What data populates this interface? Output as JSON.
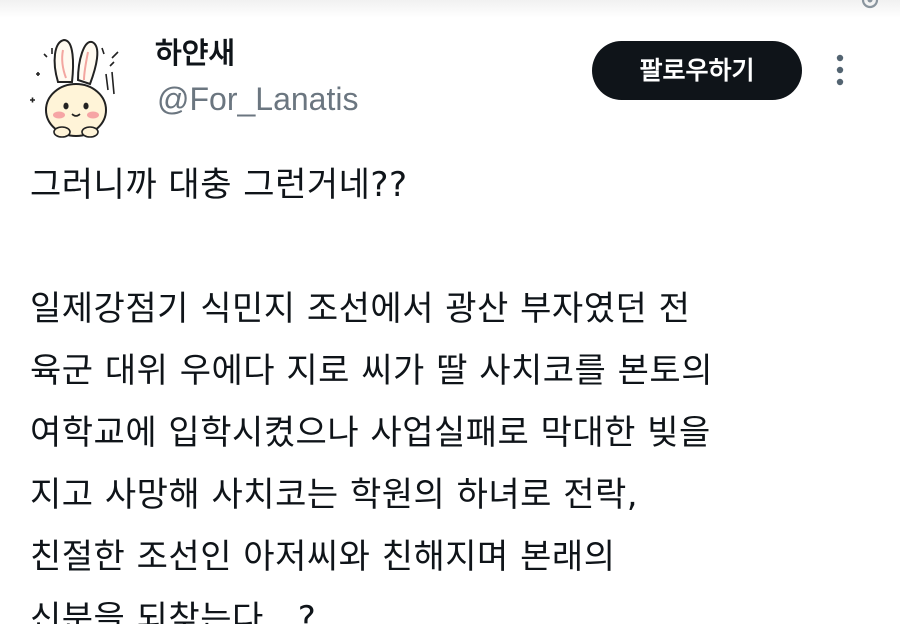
{
  "tweet": {
    "author": {
      "display_name": "하얀새",
      "handle": "@For_Lanatis",
      "avatar_icon": "bunny-avatar-icon"
    },
    "follow_label": "팔로우하기",
    "more_icon": "vertical-dots-icon",
    "body": {
      "line1": "그러니까 대충 그런거네??",
      "lines": [
        "일제강점기 식민지 조선에서 광산 부자였던 전",
        "육군 대위 우에다 지로 씨가 딸 사치코를 본토의",
        "여학교에 입학시켰으나 사업실패로 막대한 빚을",
        "지고 사망해 사치코는 학원의 하녀로 전락,",
        "친절한 조선인 아저씨와 친해지며 본래의",
        "신분을 되찾는다...?"
      ]
    }
  },
  "colors": {
    "text": "#0f1419",
    "handle": "#6b7680",
    "button_bg": "#0f1419",
    "button_text": "#ffffff"
  }
}
